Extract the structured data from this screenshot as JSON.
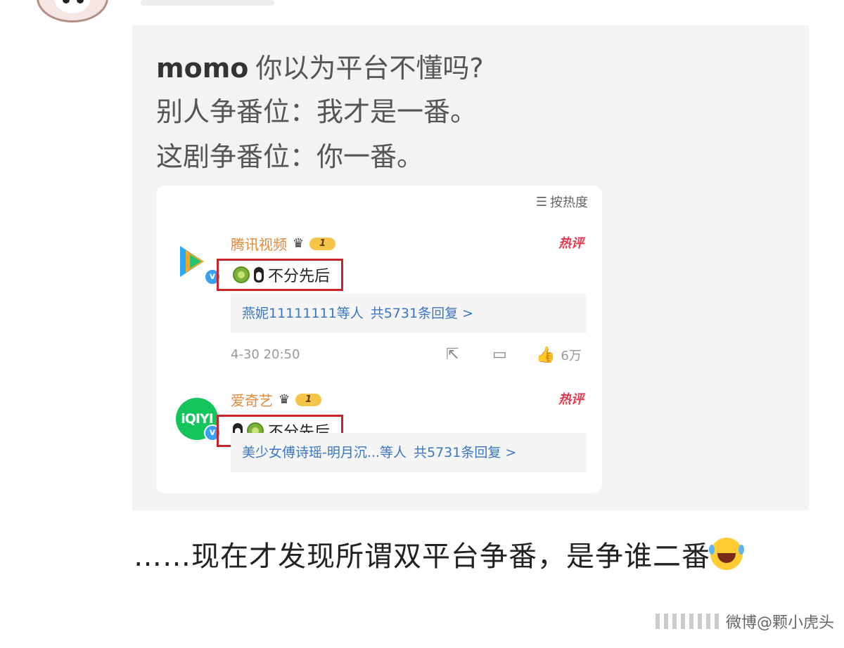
{
  "quote": {
    "username": "momo",
    "line1": "你以为平台不懂吗?",
    "line2": "别人争番位：我才是一番。",
    "line3": "这剧争番位：你一番。"
  },
  "card": {
    "sort_label": "按热度",
    "sort_icon": "sort-lines-icon",
    "comments": [
      {
        "name": "腾讯视频",
        "level": "1",
        "hot": "热评",
        "text": "不分先后",
        "reply_users": "燕妮11111111等人",
        "reply_count": "共5731条回复 >",
        "time": "4-30 20:50",
        "likes": "6万"
      },
      {
        "name": "爱奇艺",
        "logo_text": "iQIYI",
        "level": "1",
        "hot": "热评",
        "text": "不分先后",
        "reply_users": "美少女傅诗瑶-明月沉...等人",
        "reply_count": "共5731条回复 >"
      }
    ]
  },
  "main_text": "……现在才发现所谓双平台争番，是争谁二番",
  "watermark": "微博@颗小虎头",
  "colors": {
    "highlight_border": "#c8242c",
    "link": "#3a76c2",
    "hot": "#e0394d",
    "name": "#e4893a"
  }
}
